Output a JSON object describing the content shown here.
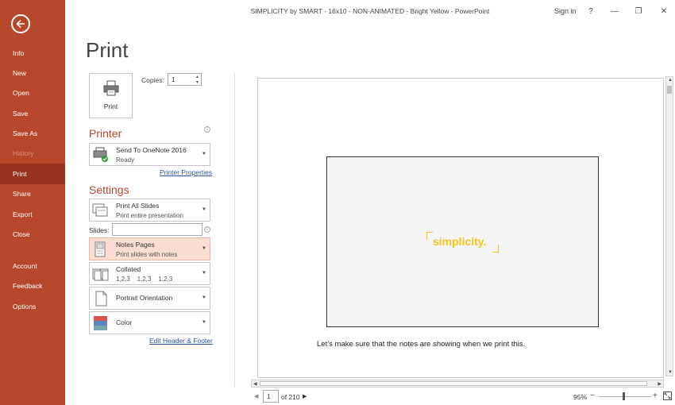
{
  "window": {
    "title": "SIMPLICITY by SMART - 16x10 - NON-ANIMATED - Bright Yellow  -  PowerPoint",
    "sign_in": "Sign in",
    "help": "?",
    "minimize": "—",
    "restore": "❐",
    "close": "✕"
  },
  "sidebar": {
    "items": [
      {
        "label": "Info"
      },
      {
        "label": "New"
      },
      {
        "label": "Open"
      },
      {
        "label": "Save"
      },
      {
        "label": "Save As"
      },
      {
        "label": "History"
      },
      {
        "label": "Print"
      },
      {
        "label": "Share"
      },
      {
        "label": "Export"
      },
      {
        "label": "Close"
      },
      {
        "label": "Account"
      },
      {
        "label": "Feedback"
      },
      {
        "label": "Options"
      }
    ],
    "active": "Print",
    "disabled": "History"
  },
  "print": {
    "heading": "Print",
    "button_label": "Print",
    "copies_label": "Copies:",
    "copies_value": "1"
  },
  "printer": {
    "heading": "Printer",
    "name": "Send To OneNote 2016",
    "status": "Ready",
    "properties_link": "Printer Properties"
  },
  "settings": {
    "heading": "Settings",
    "range_title": "Print All Slides",
    "range_sub": "Print entire presentation",
    "slides_label": "Slides:",
    "slides_value": "",
    "layout_title": "Notes Pages",
    "layout_sub": "Print slides with notes",
    "collate_title": "Collated",
    "collate_sub": "1,2,3    1,2,3    1,2,3",
    "orientation_title": "Portrait Orientation",
    "color_title": "Color",
    "header_footer_link": "Edit Header & Footer"
  },
  "preview": {
    "brand_text": "simplicity.",
    "notes_text": "Let’s make sure that the notes are showing when we print this.",
    "page_current": "1",
    "page_total": "of 210",
    "zoom": "95%",
    "zoom_minus": "−",
    "zoom_plus": "+"
  },
  "colors": {
    "accent": "#b7472a",
    "active_nav": "#98341d",
    "highlight": "#fbdcd2",
    "brand_yellow": "#f5c51c",
    "link": "#2b579a"
  }
}
